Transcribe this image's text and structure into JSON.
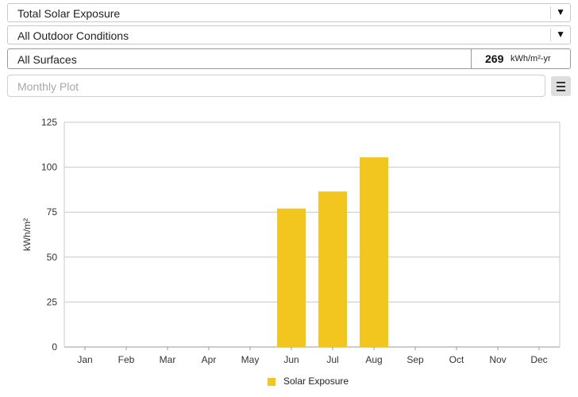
{
  "controls": {
    "metric_select": "Total Solar Exposure",
    "condition_select": "All Outdoor Conditions",
    "surface_label": "All Surfaces",
    "surface_value": "269",
    "surface_unit": "kWh/m²-yr",
    "plot_placeholder": "Monthly Plot",
    "dropdown_arrow": "▼"
  },
  "icons": {
    "dropdown": "chevron-down-icon",
    "menu": "hamburger-menu-icon"
  },
  "chart_data": {
    "type": "bar",
    "categories": [
      "Jan",
      "Feb",
      "Mar",
      "Apr",
      "May",
      "Jun",
      "Jul",
      "Aug",
      "Sep",
      "Oct",
      "Nov",
      "Dec"
    ],
    "series": [
      {
        "name": "Solar Exposure",
        "values": [
          0,
          0,
          0,
          0,
          0,
          77,
          86.5,
          105.5,
          0,
          0,
          0,
          0
        ],
        "color": "#f2c51f"
      }
    ],
    "ylabel": "kWh/m²",
    "xlabel": "",
    "ylim": [
      0,
      125
    ],
    "yticks": [
      0,
      25,
      50,
      75,
      100,
      125
    ],
    "grid": true,
    "legend": "bottom"
  }
}
